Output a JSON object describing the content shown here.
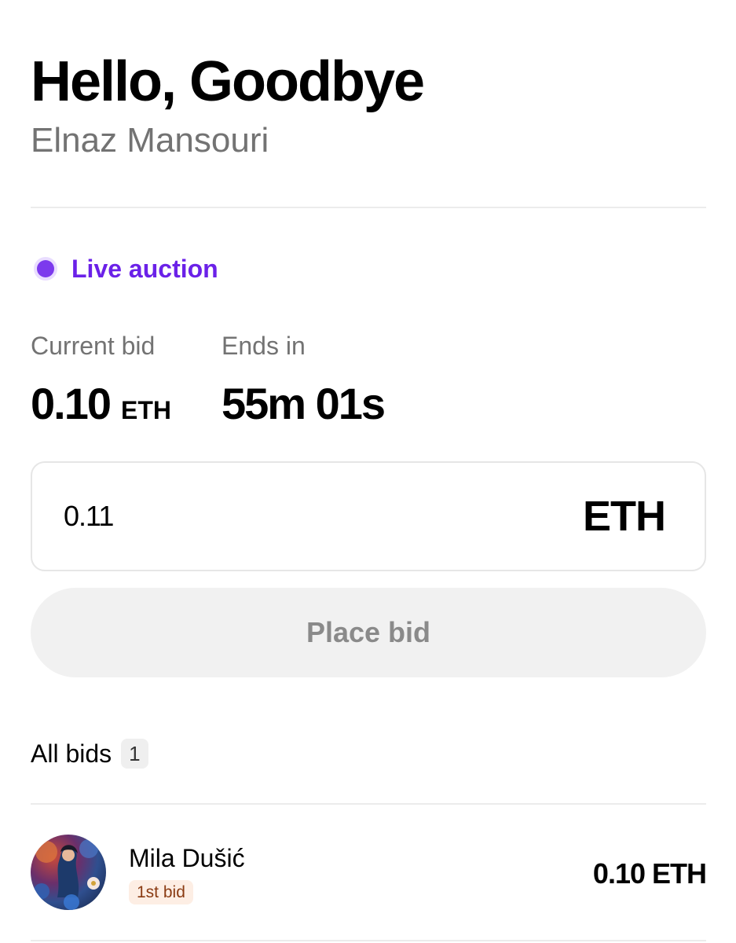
{
  "artwork": {
    "title": "Hello, Goodbye",
    "artist": "Elnaz Mansouri"
  },
  "auction": {
    "status_label": "Live auction",
    "status_color": "#6b21e8",
    "current_bid_label": "Current bid",
    "current_bid_value": "0.10",
    "current_bid_unit": "ETH",
    "ends_in_label": "Ends in",
    "ends_in_value": "55m 01s"
  },
  "bid_form": {
    "input_value": "0.11",
    "currency": "ETH",
    "submit_label": "Place bid"
  },
  "bids": {
    "title": "All bids",
    "count": "1",
    "items": [
      {
        "bidder": "Mila Dušić",
        "badge": "1st bid",
        "amount": "0.10 ETH",
        "avatar_icon": "avatar-artwork"
      }
    ]
  }
}
